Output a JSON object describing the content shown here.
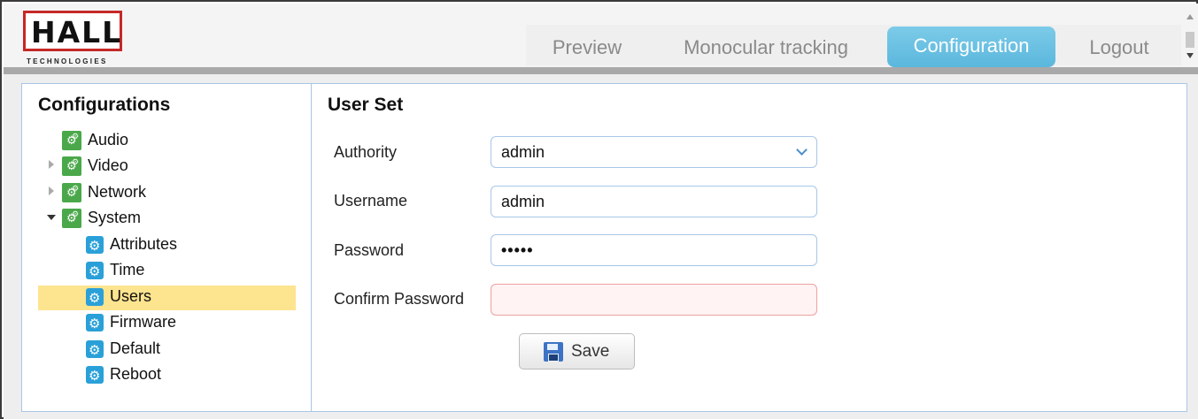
{
  "brand": {
    "logo_text": "HALL",
    "logo_subtext": "TECHNOLOGIES",
    "accent_color": "#c62828"
  },
  "nav": {
    "items": [
      {
        "label": "Preview",
        "active": false
      },
      {
        "label": "Monocular tracking",
        "active": false
      },
      {
        "label": "Configuration",
        "active": true
      },
      {
        "label": "Logout",
        "active": false
      }
    ],
    "active_color": "#5bb7dd"
  },
  "sidebar": {
    "title": "Configurations",
    "items": [
      {
        "label": "Audio",
        "icon": "gear-group-icon",
        "expandable": false
      },
      {
        "label": "Video",
        "icon": "gear-group-icon",
        "expandable": true,
        "expanded": false
      },
      {
        "label": "Network",
        "icon": "gear-group-icon",
        "expandable": true,
        "expanded": false
      },
      {
        "label": "System",
        "icon": "gear-group-icon",
        "expandable": true,
        "expanded": true,
        "children": [
          {
            "label": "Attributes",
            "icon": "gear-icon"
          },
          {
            "label": "Time",
            "icon": "gear-icon"
          },
          {
            "label": "Users",
            "icon": "gear-icon",
            "selected": true
          },
          {
            "label": "Firmware",
            "icon": "gear-icon"
          },
          {
            "label": "Default",
            "icon": "gear-icon"
          },
          {
            "label": "Reboot",
            "icon": "gear-icon"
          }
        ]
      }
    ],
    "selected_color": "#fde48f"
  },
  "form": {
    "title": "User Set",
    "fields": {
      "authority": {
        "label": "Authority",
        "value": "admin",
        "type": "select"
      },
      "username": {
        "label": "Username",
        "value": "admin"
      },
      "password": {
        "label": "Password",
        "value": "•••••"
      },
      "confirm_password": {
        "label": "Confirm Password",
        "value": "",
        "invalid": true
      }
    },
    "save_label": "Save"
  }
}
